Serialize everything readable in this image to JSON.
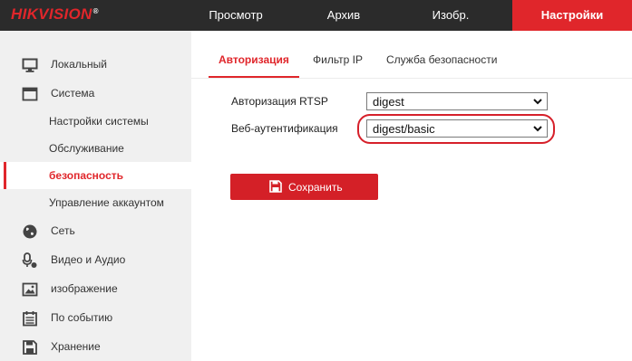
{
  "header": {
    "logo": "HIKVISION",
    "logo_mark": "®",
    "nav": [
      {
        "label": "Просмотр",
        "active": false
      },
      {
        "label": "Архив",
        "active": false
      },
      {
        "label": "Изобр.",
        "active": false
      },
      {
        "label": "Настройки",
        "active": true
      }
    ]
  },
  "sidebar": {
    "items": [
      {
        "label": "Локальный",
        "icon": "monitor-icon"
      },
      {
        "label": "Система",
        "icon": "window-icon"
      },
      {
        "label": "Сеть",
        "icon": "globe-icon"
      },
      {
        "label": "Видео и Аудио",
        "icon": "microphone-icon"
      },
      {
        "label": "изображение",
        "icon": "image-icon"
      },
      {
        "label": "По событию",
        "icon": "calendar-icon"
      },
      {
        "label": "Хранение",
        "icon": "floppy-disk-icon"
      }
    ],
    "system_sub": [
      {
        "label": "Настройки системы"
      },
      {
        "label": "Обслуживание"
      },
      {
        "label": "безопасность",
        "active": true
      },
      {
        "label": "Управление аккаунтом"
      }
    ]
  },
  "tabs": [
    {
      "label": "Авторизация",
      "active": true
    },
    {
      "label": "Фильтр IP"
    },
    {
      "label": "Служба безопасности"
    }
  ],
  "form": {
    "rtsp": {
      "label": "Авторизация RTSP",
      "value": "digest"
    },
    "web": {
      "label": "Веб-аутентификация",
      "value": "digest/basic"
    },
    "save_label": "Сохранить"
  },
  "colors": {
    "accent": "#e0262b",
    "topbar": "#2b2b2b",
    "sidebar": "#f0f0f0"
  }
}
